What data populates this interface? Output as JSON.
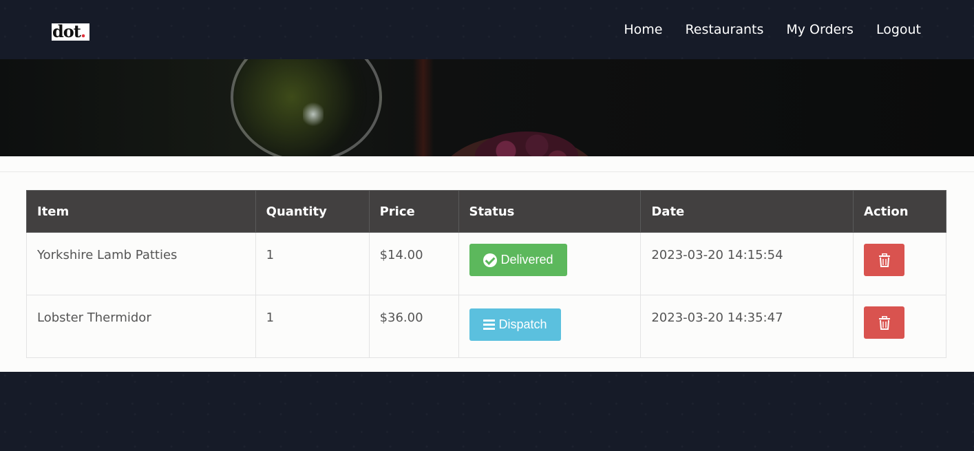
{
  "brand": {
    "logo_text": "dot",
    "logo_dot": "."
  },
  "nav": {
    "items": [
      {
        "label": "Home"
      },
      {
        "label": "Restaurants"
      },
      {
        "label": "My Orders"
      },
      {
        "label": "Logout"
      }
    ]
  },
  "orders_table": {
    "headers": {
      "item": "Item",
      "quantity": "Quantity",
      "price": "Price",
      "status": "Status",
      "date": "Date",
      "action": "Action"
    },
    "rows": [
      {
        "item": "Yorkshire Lamb Patties",
        "quantity": "1",
        "price": "$14.00",
        "status": "Delivered",
        "status_icon": "check-circle-icon",
        "status_color": "#5cb85c",
        "date": "2023-03-20 14:15:54",
        "action_icon": "trash-icon"
      },
      {
        "item": "Lobster Thermidor",
        "quantity": "1",
        "price": "$36.00",
        "status": "Dispatch",
        "status_icon": "bars-icon",
        "status_color": "#5bc0de",
        "date": "2023-03-20 14:35:47",
        "action_icon": "trash-icon"
      }
    ]
  },
  "colors": {
    "header_bg": "#424040",
    "delete_button": "#d9534f",
    "page_bg": "#161b28"
  }
}
